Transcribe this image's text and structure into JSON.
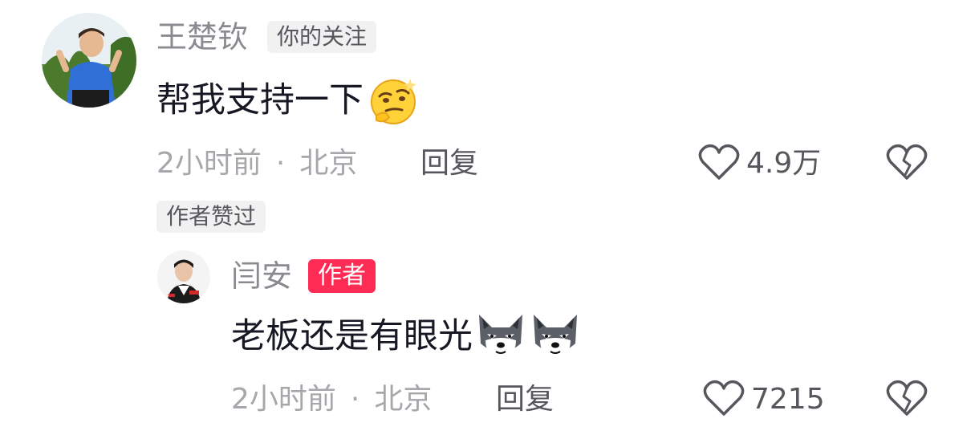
{
  "comments": [
    {
      "username": "王楚钦",
      "badge": "你的关注",
      "text": "帮我支持一下",
      "emoji": "thinking-face-emoji",
      "time": "2小时前",
      "separator": "·",
      "location": "北京",
      "reply_label": "回复",
      "likes": "4.9万",
      "author_liked": "作者赞过",
      "avatar_colors": {
        "shirt": "#2f6fd6",
        "sky": "#e9f0f4",
        "plants": "#5b8a3a"
      }
    },
    {
      "username": "闫安",
      "badge": "作者",
      "text": "老板还是有眼光",
      "emoji": "wolf-face-emoji",
      "time": "2小时前",
      "separator": "·",
      "location": "北京",
      "reply_label": "回复",
      "likes": "7215",
      "avatar_colors": {
        "jacket": "#1c1c1c",
        "stripe": "#d62a2a",
        "bg": "#f4f4f4"
      }
    }
  ],
  "icons": {
    "like": "heart-outline-icon",
    "dislike": "broken-heart-icon"
  },
  "colors": {
    "author_badge": "#fe2c55",
    "muted_text": "#a6a7ab",
    "username": "#8a8b91"
  }
}
